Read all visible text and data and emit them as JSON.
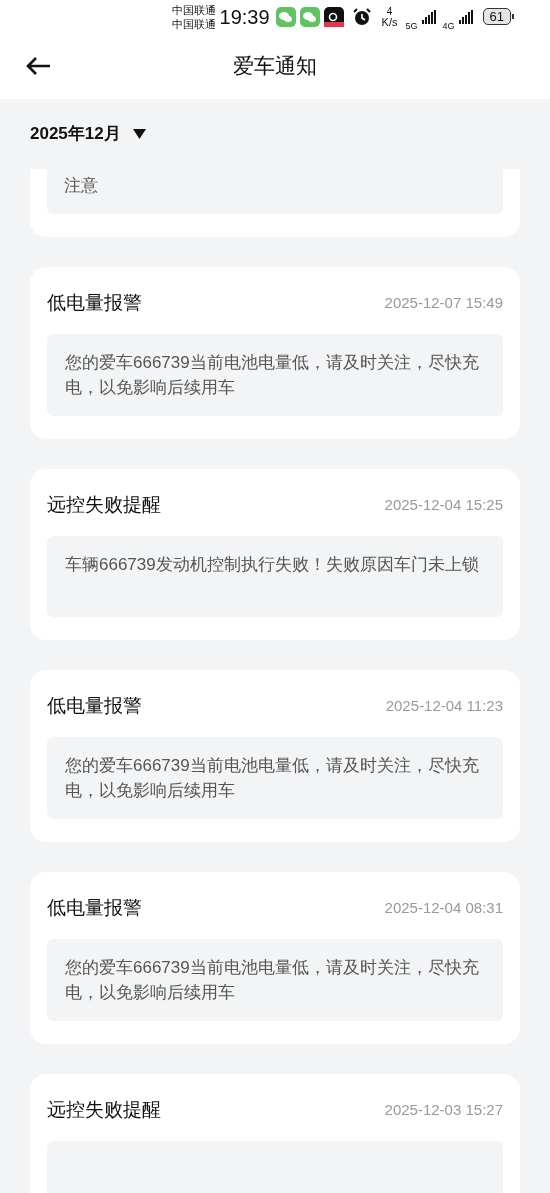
{
  "status_bar": {
    "carriers": [
      "中国联通",
      "中国联通"
    ],
    "time": "19:39",
    "speed_value": "4",
    "speed_unit": "K/s",
    "network_1": "5G",
    "network_2": "4G",
    "battery": "61"
  },
  "header": {
    "title": "爱车通知"
  },
  "month_filter": {
    "label": "2025年12月"
  },
  "notifications": [
    {
      "partial": true,
      "body": "注意"
    },
    {
      "title": "低电量报警",
      "time": "2025-12-07 15:49",
      "body": "您的爱车666739当前电池电量低，请及时关注，尽快充电，以免影响后续用车"
    },
    {
      "title": "远控失败提醒",
      "time": "2025-12-04 15:25",
      "body": "车辆666739发动机控制执行失败！失败原因车门未上锁"
    },
    {
      "title": "低电量报警",
      "time": "2025-12-04 11:23",
      "body": "您的爱车666739当前电池电量低，请及时关注，尽快充电，以免影响后续用车"
    },
    {
      "title": "低电量报警",
      "time": "2025-12-04 08:31",
      "body": "您的爱车666739当前电池电量低，请及时关注，尽快充电，以免影响后续用车"
    },
    {
      "title": "远控失败提醒",
      "time": "2025-12-03 15:27"
    }
  ]
}
